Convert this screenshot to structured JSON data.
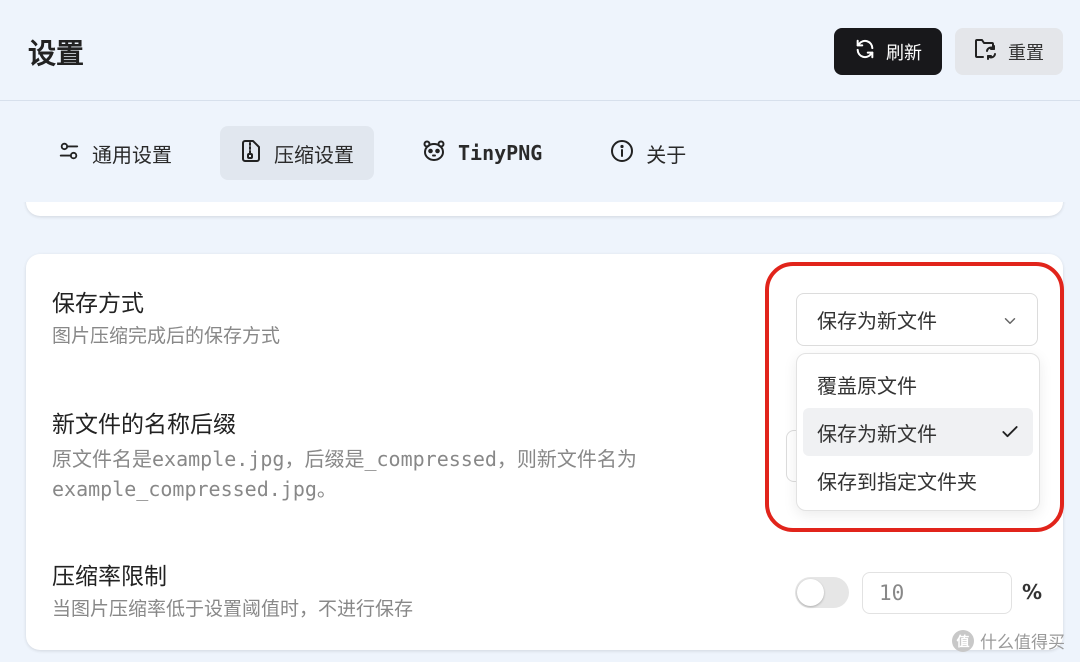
{
  "header": {
    "title": "设置",
    "refresh_label": "刷新",
    "reset_label": "重置"
  },
  "tabs": [
    {
      "label": "通用设置",
      "icon": "sliders-icon"
    },
    {
      "label": "压缩设置",
      "icon": "file-zip-icon",
      "active": true
    },
    {
      "label": "TinyPNG",
      "icon": "panda-icon"
    },
    {
      "label": "关于",
      "icon": "info-icon"
    }
  ],
  "settings": {
    "save_mode": {
      "title": "保存方式",
      "desc": "图片压缩完成后的保存方式",
      "selected": "保存为新文件",
      "options": [
        "覆盖原文件",
        "保存为新文件",
        "保存到指定文件夹"
      ]
    },
    "suffix": {
      "title": "新文件的名称后缀",
      "desc_line1": "原文件名是example.jpg，后缀是_compressed，则新文件名为",
      "desc_line2": "example_compressed.jpg。"
    },
    "ratio_limit": {
      "title": "压缩率限制",
      "desc": "当图片压缩率低于设置阈值时，不进行保存",
      "enabled": false,
      "value": "10",
      "unit": "%"
    }
  },
  "watermark": {
    "logo_text": "值",
    "text": "什么值得买"
  },
  "colors": {
    "accent_dark": "#18181b",
    "highlight_red": "#e1241b",
    "background": "#eef4fc"
  }
}
